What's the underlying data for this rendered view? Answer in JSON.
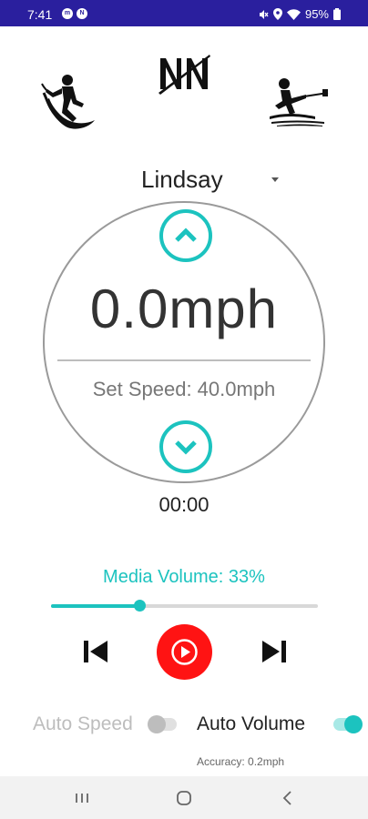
{
  "status_bar": {
    "time": "7:41",
    "battery": "95%",
    "badge_icons": [
      "messenger-icon",
      "notification-badge-icon"
    ],
    "system_icons": [
      "mute-icon",
      "location-icon",
      "wifi-icon",
      "battery-icon"
    ]
  },
  "header": {
    "left_icon": "surfing-icon",
    "center_logo": "brand-logo",
    "right_icon": "wakeboard-icon"
  },
  "profile": {
    "selected": "Lindsay"
  },
  "speed": {
    "current": "0.0mph",
    "set_speed": "Set Speed: 40.0mph",
    "up_icon": "chevron-up-icon",
    "down_icon": "chevron-down-icon"
  },
  "timer": "00:00",
  "volume": {
    "label": "Media Volume: 33%",
    "level": 0.33
  },
  "media_controls": {
    "previous_icon": "skip-previous-icon",
    "play_icon": "play-icon",
    "next_icon": "skip-next-icon"
  },
  "toggles": {
    "auto_speed": {
      "label": "Auto Speed",
      "on": false
    },
    "auto_volume": {
      "label": "Auto Volume",
      "on": true
    }
  },
  "accuracy": "Accuracy: 0.2mph",
  "nav_bar": {
    "recent_icon": "recent-apps-icon",
    "home_icon": "home-icon",
    "back_icon": "back-icon"
  },
  "colors": {
    "status_bar": "#2a1f9e",
    "accent": "#1cc3bf",
    "play_button": "#ff1313"
  }
}
